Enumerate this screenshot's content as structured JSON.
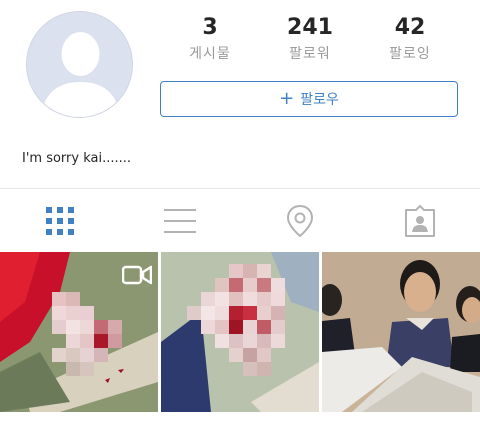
{
  "profile": {
    "bio": "I'm sorry kai......."
  },
  "stats": [
    {
      "value": "3",
      "label": "게시물"
    },
    {
      "value": "241",
      "label": "팔로워"
    },
    {
      "value": "42",
      "label": "팔로잉"
    }
  ],
  "follow_button": {
    "icon": "+",
    "label": "팔로우"
  },
  "tabs": [
    {
      "name": "grid-view",
      "icon": "grid-icon",
      "active": true
    },
    {
      "name": "list-view",
      "icon": "list-icon",
      "active": false
    },
    {
      "name": "places",
      "icon": "location-pin-icon",
      "active": false
    },
    {
      "name": "tagged",
      "icon": "tagged-person-icon",
      "active": false
    }
  ],
  "colors": {
    "accent": "#3f81c4",
    "inactive_icon": "#b3b3b3",
    "avatar_bg": "#dbe1ee"
  },
  "posts": [
    {
      "type": "video"
    },
    {
      "type": "photo"
    },
    {
      "type": "photo"
    }
  ]
}
